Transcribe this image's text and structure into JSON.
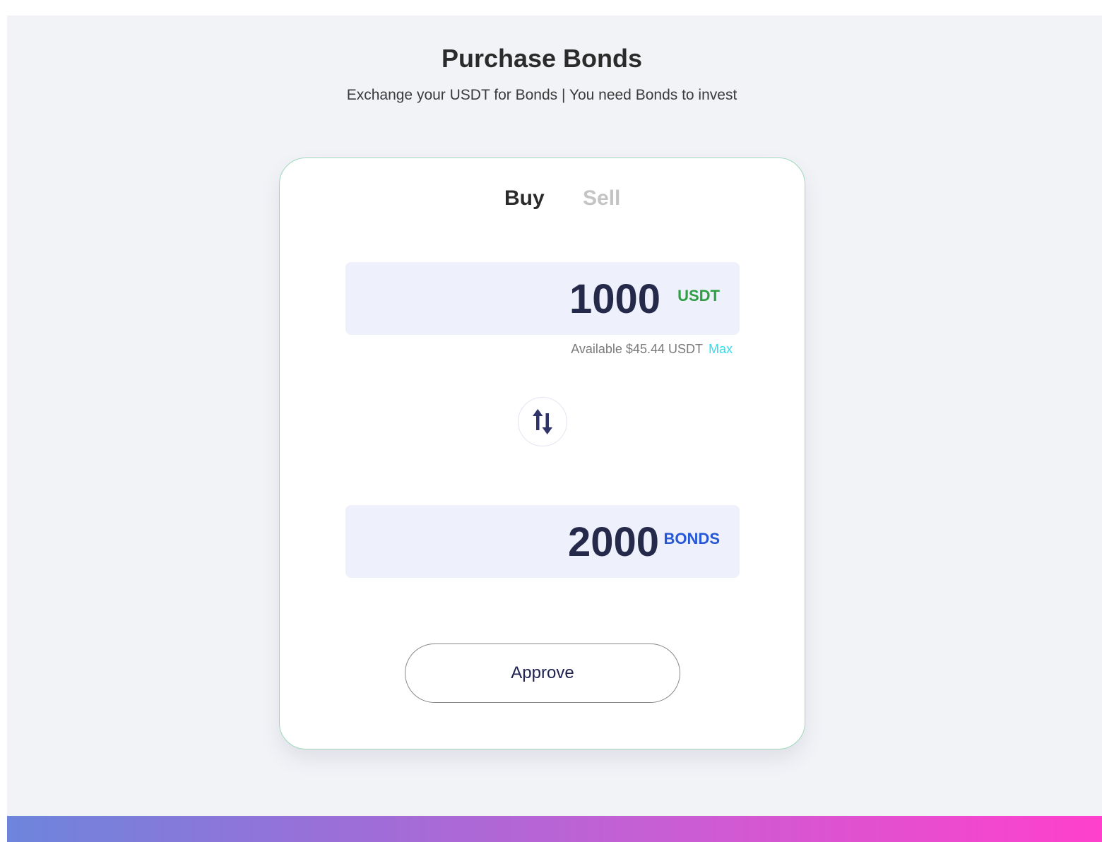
{
  "header": {
    "title": "Purchase Bonds",
    "subtitle": "Exchange your USDT for Bonds | You need Bonds to invest"
  },
  "tabs": [
    {
      "label": "Buy",
      "active": true
    },
    {
      "label": "Sell",
      "active": false
    }
  ],
  "from_field": {
    "value": "1000",
    "unit": "USDT",
    "available_text": "Available $45.44 USDT",
    "max_label": "Max"
  },
  "swap": {
    "icon": "swap-vertical-arrows-icon"
  },
  "to_field": {
    "value": "2000",
    "unit": "BONDS"
  },
  "approve_label": "Approve",
  "colors": {
    "usdt": "#2ea043",
    "bonds": "#2557d6",
    "max_link": "#2ee0f0",
    "card_border": "#9fd9bd",
    "amount_text": "#262a4a"
  }
}
